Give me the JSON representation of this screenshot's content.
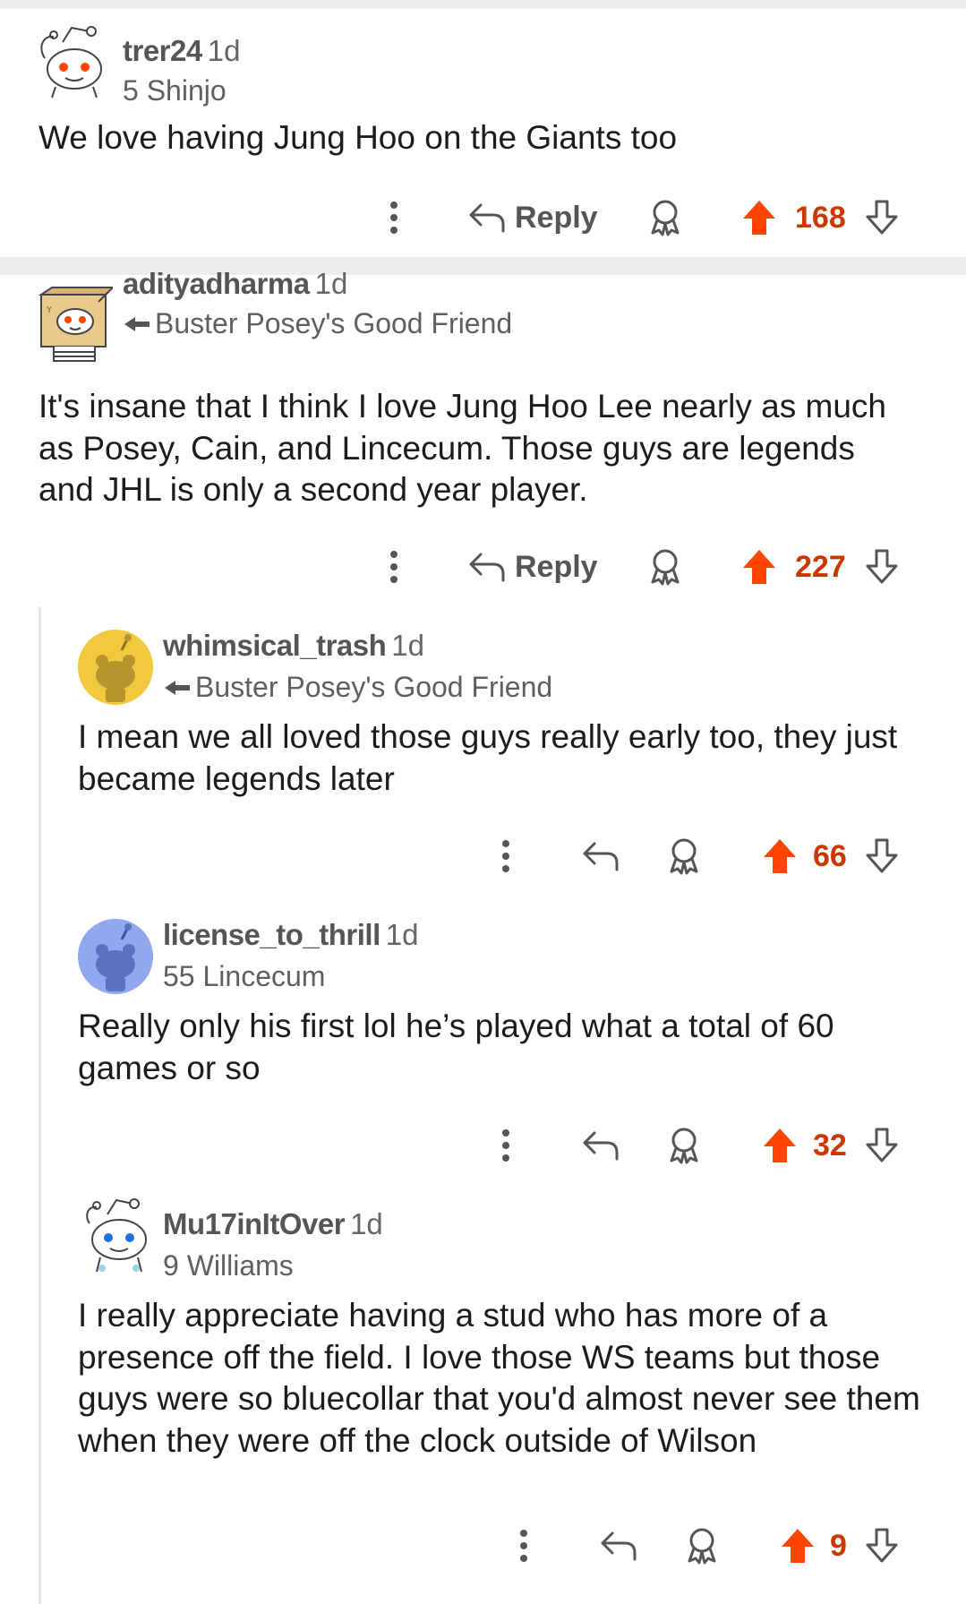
{
  "comments": [
    {
      "username": "trer24",
      "age": "1d",
      "flair": "5 Shinjo",
      "flair_arrow": false,
      "avatar": "snoo-default-avatar",
      "body": "We love having Jung Hoo on the Giants too",
      "show_reply_label": true,
      "reply_label": "Reply",
      "score": "168",
      "upvoted": true
    },
    {
      "username": "adityadharma",
      "age": "1d",
      "flair": "Buster Posey's Good Friend",
      "flair_arrow": true,
      "avatar": "snoo-box-costume-avatar",
      "body": "It's insane that I think I love Jung Hoo Lee nearly as much as Posey, Cain, and Lincecum. Those guys are legends and JHL is only a second year player.",
      "show_reply_label": true,
      "reply_label": "Reply",
      "score": "227",
      "upvoted": true
    },
    {
      "username": "whimsical_trash",
      "age": "1d",
      "flair": "Buster Posey's Good Friend",
      "flair_arrow": true,
      "avatar": "snoo-yellow-avatar",
      "body": "I mean we all loved those guys really early too, they just became legends later",
      "show_reply_label": false,
      "score": "66",
      "upvoted": true
    },
    {
      "username": "license_to_thrill",
      "age": "1d",
      "flair": "55 Lincecum",
      "flair_arrow": false,
      "avatar": "snoo-blue-avatar",
      "body": "Really only his first lol he’s played what a total of 60 games or so",
      "show_reply_label": false,
      "score": "32",
      "upvoted": true
    },
    {
      "username": "Mu17inItOver",
      "age": "1d",
      "flair": "9 Williams",
      "flair_arrow": false,
      "avatar": "snoo-default-blue-eye-avatar",
      "body": "I really appreciate having a stud who has more of a presence off the field. I love those WS teams but those guys were so bluecollar that you'd almost never see them when they were off the clock outside of Wilson",
      "show_reply_label": false,
      "score": "9",
      "upvoted": true
    }
  ],
  "colors": {
    "upvote": "#ff4500",
    "score": "#cc3700",
    "username": "#555555",
    "meta": "#666666",
    "text": "#1c1c1c",
    "icon": "#555555",
    "divider": "#ededed",
    "thread_line": "#e6e6e6"
  },
  "icons": {
    "more": "more-vertical-icon",
    "reply": "reply-arrow-icon",
    "award": "award-icon",
    "upvote": "upvote-arrow-icon",
    "downvote": "downvote-arrow-icon",
    "flair_arrow": "flair-arrow-icon"
  }
}
